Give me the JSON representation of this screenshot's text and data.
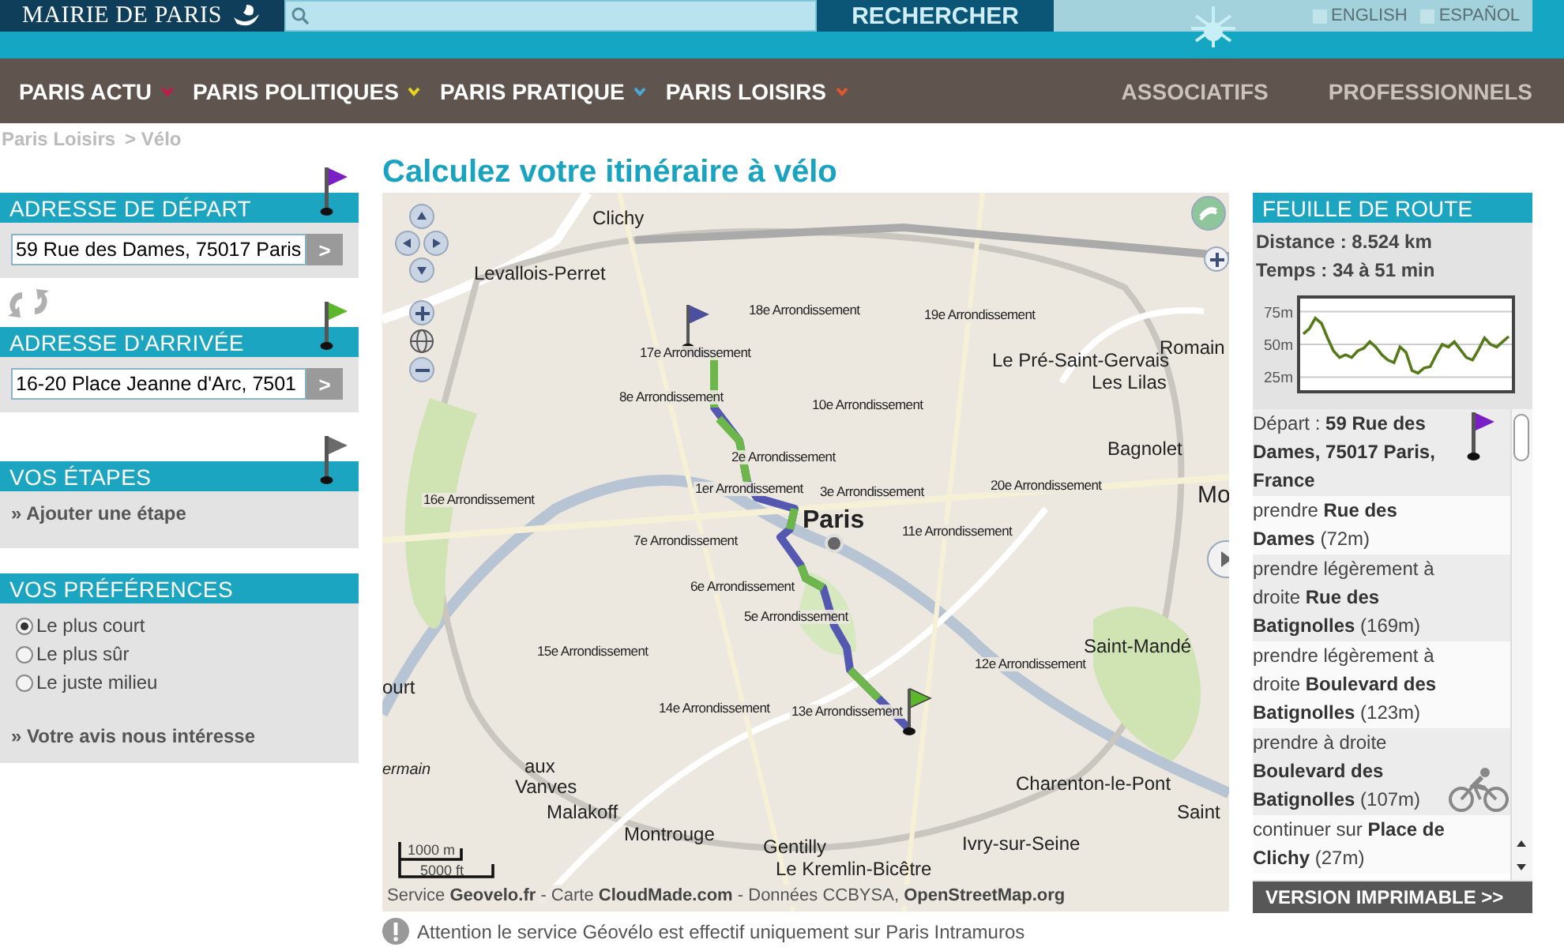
{
  "header": {
    "logo": "MAIRIE DE PARIS",
    "search_button": "RECHERCHER",
    "languages": [
      {
        "label": "ENGLISH"
      },
      {
        "label": "ESPAÑOL"
      }
    ]
  },
  "nav": {
    "items": [
      {
        "label": "PARIS ACTU",
        "color": "#c8174a"
      },
      {
        "label": "PARIS POLITIQUES",
        "color": "#e6d51c"
      },
      {
        "label": "PARIS PRATIQUE",
        "color": "#4aa8d8"
      },
      {
        "label": "PARIS LOISIRS",
        "color": "#e2572a"
      }
    ],
    "secondary": [
      "ASSOCIATIFS",
      "PROFESSIONNELS"
    ]
  },
  "breadcrumb": [
    "Paris Loisirs",
    "> Vélo"
  ],
  "page_title": "Calculez votre itinéraire à vélo",
  "panels": [
    {
      "kind": "address",
      "title": "ADRESSE DE DÉPART",
      "value": "59 Rue des Dames, 75017 Paris",
      "button": ">",
      "color": "#7a1fc8"
    },
    {
      "kind": "address",
      "title": "ADRESSE D'ARRIVÉE",
      "value": "16-20 Place Jeanne d'Arc, 7501",
      "button": ">",
      "color": "#5cb82a"
    },
    {
      "kind": "steps",
      "title": "VOS ÉTAPES",
      "link": "» Ajouter une étape",
      "color": "#6a6a6a"
    },
    {
      "kind": "preferences",
      "title": "VOS PRÉFÉRENCES",
      "options": [
        {
          "label": "Le plus court",
          "selected": true
        },
        {
          "label": "Le plus sûr",
          "selected": false
        },
        {
          "label": "Le juste milieu",
          "selected": false
        }
      ],
      "link": "» Votre avis nous intéresse"
    }
  ],
  "map": {
    "labels": [
      {
        "text": "Clichy",
        "kind": "town"
      },
      {
        "text": "Levallois-Perret",
        "kind": "town"
      },
      {
        "text": "18e Arrondissement",
        "kind": "district"
      },
      {
        "text": "19e Arrondissement",
        "kind": "district"
      },
      {
        "text": "17e Arrondissement",
        "kind": "district"
      },
      {
        "text": "Le Pré-Saint-Gervais",
        "kind": "town"
      },
      {
        "text": "Les Lilas",
        "kind": "town"
      },
      {
        "text": "Romain",
        "kind": "town"
      },
      {
        "text": "8e Arrondissement",
        "kind": "district"
      },
      {
        "text": "10e Arrondissement",
        "kind": "district"
      },
      {
        "text": "Bagnolet",
        "kind": "town"
      },
      {
        "text": "2e Arrondissement",
        "kind": "district"
      },
      {
        "text": "20e Arrondissement",
        "kind": "district"
      },
      {
        "text": "16e Arrondissement",
        "kind": "district"
      },
      {
        "text": "1er Arrondissement",
        "kind": "district"
      },
      {
        "text": "3e Arrondissement",
        "kind": "district"
      },
      {
        "text": "Mo",
        "kind": "city"
      },
      {
        "text": "Paris",
        "kind": "capital"
      },
      {
        "text": "11e Arrondissement",
        "kind": "district"
      },
      {
        "text": "7e Arrondissement",
        "kind": "district"
      },
      {
        "text": "6e Arrondissement",
        "kind": "district"
      },
      {
        "text": "5e Arrondissement",
        "kind": "district"
      },
      {
        "text": "15e Arrondissement",
        "kind": "district"
      },
      {
        "text": "Saint-Mandé",
        "kind": "town"
      },
      {
        "text": "12e Arrondissement",
        "kind": "district"
      },
      {
        "text": "ourt",
        "kind": "town"
      },
      {
        "text": "14e Arrondissement",
        "kind": "district"
      },
      {
        "text": "13e Arrondissement",
        "kind": "district"
      },
      {
        "text": "ermain",
        "kind": "italic"
      },
      {
        "text": "aux",
        "kind": "town"
      },
      {
        "text": "Vanves",
        "kind": "town"
      },
      {
        "text": "Charenton-le-Pont",
        "kind": "town"
      },
      {
        "text": "Malakoff",
        "kind": "town"
      },
      {
        "text": "Saint",
        "kind": "town"
      },
      {
        "text": "Montrouge",
        "kind": "town"
      },
      {
        "text": "Gentilly",
        "kind": "town"
      },
      {
        "text": "Ivry-sur-Seine",
        "kind": "town"
      },
      {
        "text": "Le Kremlin-Bicêtre",
        "kind": "town"
      }
    ],
    "scale": [
      "1000 m",
      "5000 ft"
    ],
    "attribution": "Service **Geovelo.fr** - Carte **CloudMade.com** - Données CCBYSA, **OpenStreetMap.org**"
  },
  "notice": "Attention le service Géovélo est effectif uniquement sur Paris Intramuros",
  "roadmap": {
    "title": "FEUILLE DE ROUTE",
    "distance": "Distance : 8.524 km",
    "time": "Temps : 34 à 51 min",
    "chart_data": {
      "type": "line",
      "grid": true,
      "ylim": [
        15,
        85
      ],
      "yticks": [
        {
          "value": 25,
          "label": "25m"
        },
        {
          "value": 50,
          "label": "50m"
        },
        {
          "value": 75,
          "label": "75m"
        }
      ],
      "values": [
        58,
        62,
        70,
        66,
        55,
        45,
        40,
        42,
        40,
        45,
        47,
        52,
        48,
        42,
        38,
        36,
        48,
        44,
        30,
        28,
        32,
        33,
        42,
        50,
        48,
        52,
        46,
        40,
        38,
        46,
        55,
        50,
        48,
        52,
        56
      ]
    },
    "steps": [
      {
        "kind": "start",
        "text": "Départ : **59 Rue des Dames, 75017 Paris, France**"
      },
      {
        "kind": "plain",
        "text": "prendre **Rue des Dames** (72m)"
      },
      {
        "kind": "plain",
        "text": "prendre légèrement à droite **Rue des Batignolles** (169m)"
      },
      {
        "kind": "plain",
        "text": "prendre légèrement à droite **Boulevard des Batignolles** (123m)"
      },
      {
        "kind": "cycle",
        "text": "prendre à droite **Boulevard des Batignolles** (107m)"
      },
      {
        "kind": "plain",
        "text": "continuer sur **Place de Clichy** (27m)"
      }
    ],
    "print_button": "VERSION IMPRIMABLE >>"
  }
}
